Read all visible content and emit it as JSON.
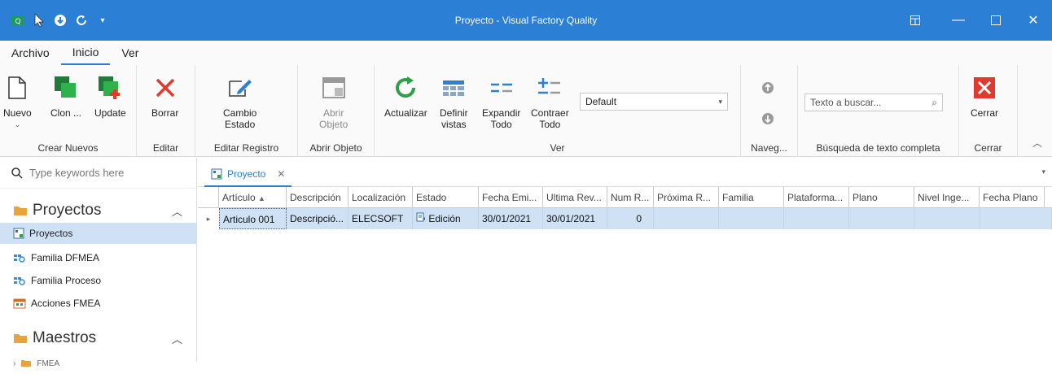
{
  "window": {
    "title": "Proyecto - Visual Factory Quality"
  },
  "ribbon_tabs": [
    "Archivo",
    "Inicio",
    "Ver"
  ],
  "ribbon": {
    "crear": {
      "label": "Crear Nuevos",
      "nuevo": "Nuevo",
      "clon": "Clon ...",
      "update": "Update"
    },
    "editar": {
      "label": "Editar",
      "borrar": "Borrar"
    },
    "registro": {
      "label": "Editar Registro",
      "cambio1": "Cambio",
      "cambio2": "Estado"
    },
    "abrir": {
      "label": "Abrir Objeto",
      "btn1": "Abrir",
      "btn2": "Objeto"
    },
    "ver": {
      "label": "Ver",
      "actualizar": "Actualizar",
      "definir1": "Definir",
      "definir2": "vistas",
      "expandir1": "Expandir",
      "expandir2": "Todo",
      "contraer1": "Contraer",
      "contraer2": "Todo",
      "view_combo": "Default"
    },
    "naveg": {
      "label": "Naveg..."
    },
    "busqueda": {
      "label": "Búsqueda de texto completa",
      "placeholder": "Texto a buscar..."
    },
    "cerrar": {
      "label": "Cerrar",
      "btn": "Cerrar"
    }
  },
  "sidebar": {
    "search_placeholder": "Type keywords here",
    "section1": "Proyectos",
    "items": [
      "Proyectos",
      "Familia DFMEA",
      "Familia Proceso",
      "Acciones FMEA"
    ],
    "section2": "Maestros",
    "sub_item": "FMEA"
  },
  "doc_tab": {
    "label": "Proyecto"
  },
  "grid": {
    "columns": [
      "Artículo",
      "Descripción",
      "Localización",
      "Estado",
      "Fecha Emi...",
      "Ultima Rev...",
      "Num R...",
      "Próxima R...",
      "Familia",
      "Plataforma...",
      "Plano",
      "Nivel Inge...",
      "Fecha Plano"
    ],
    "rows": [
      [
        "Articulo 001",
        "Descripció...",
        "ELECSOFT",
        "Edición",
        "30/01/2021",
        "30/01/2021",
        "0",
        "",
        "",
        "",
        "",
        "",
        ""
      ]
    ]
  },
  "colors": {
    "accent": "#2b7fd4",
    "selection": "#cfe2f5",
    "green": "#2e9e47",
    "red": "#e03a2f"
  }
}
